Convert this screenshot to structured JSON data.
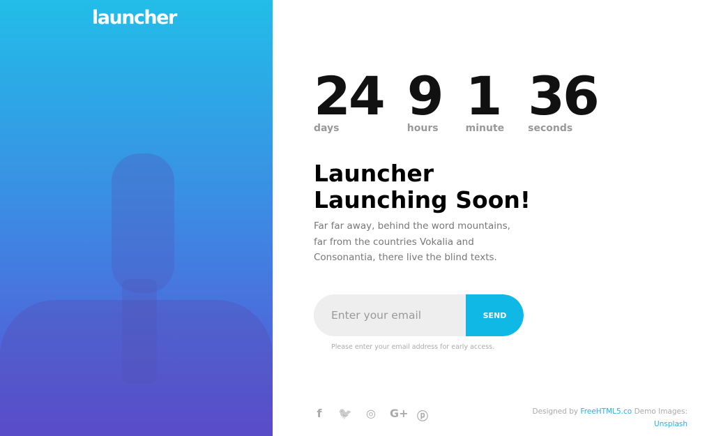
{
  "brand": {
    "logo": "launcher"
  },
  "countdown": [
    {
      "value": "24",
      "label": "days"
    },
    {
      "value": "9",
      "label": "hours"
    },
    {
      "value": "1",
      "label": "minute"
    },
    {
      "value": "36",
      "label": "seconds"
    }
  ],
  "headline": {
    "line1": "Launcher",
    "line2": "Launching Soon!"
  },
  "description": "Far far away, behind the word mountains, far from the countries Vokalia and Consonantia, there live the blind texts.",
  "form": {
    "email_placeholder": "Enter your email",
    "send_label": "SEND",
    "hint": "Please enter your email address for early access."
  },
  "social": [
    {
      "icon": "facebook-icon",
      "glyph": "f"
    },
    {
      "icon": "twitter-icon",
      "glyph": "🐦"
    },
    {
      "icon": "instagram-icon",
      "glyph": "◎"
    },
    {
      "icon": "google-plus-icon",
      "glyph": "G+"
    },
    {
      "icon": "pinterest-icon",
      "glyph": "ⓟ"
    }
  ],
  "footer": {
    "designed_by": "Designed by",
    "designer_link": "FreeHTML5.co",
    "demo_images": "Demo Images:",
    "images_link": "Unsplash"
  },
  "colors": {
    "accent": "#10b8e6",
    "gradient_top": "#22bde8",
    "gradient_bottom": "#5a4fd6"
  }
}
